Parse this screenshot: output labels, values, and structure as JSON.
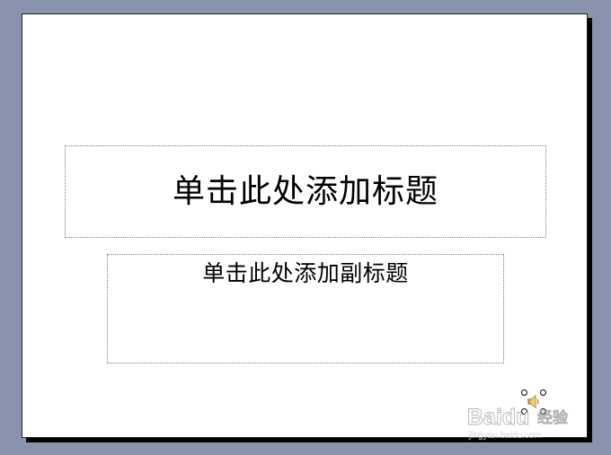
{
  "slide": {
    "title_placeholder": "单击此处添加标题",
    "subtitle_placeholder": "单击此处添加副标题"
  },
  "objects": {
    "sound_icon": "speaker-icon"
  },
  "watermark": {
    "brand": "Baidu",
    "product": "经验",
    "url": "jingyan.baidu.com"
  },
  "colors": {
    "workspace_background": "#8a93ad",
    "slide_background": "#ffffff",
    "slide_shadow": "#000000",
    "placeholder_border": "#7a7a7a"
  }
}
